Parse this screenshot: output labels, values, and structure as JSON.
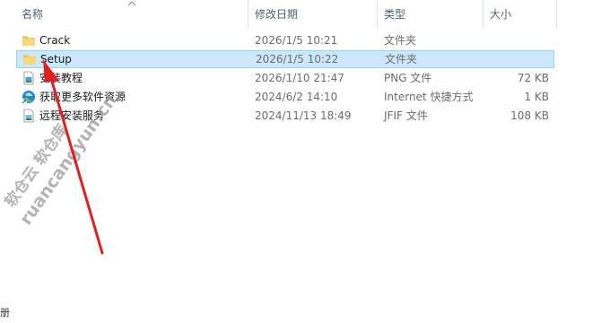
{
  "columns": {
    "name": "名称",
    "modified": "修改日期",
    "type": "类型",
    "size": "大小"
  },
  "files": [
    {
      "icon": "folder-icon",
      "name": "Crack",
      "modified": "2026/1/5 10:21",
      "type": "文件夹",
      "size": "",
      "selected": false
    },
    {
      "icon": "folder-icon",
      "name": "Setup",
      "modified": "2026/1/5 10:22",
      "type": "文件夹",
      "size": "",
      "selected": true
    },
    {
      "icon": "png-file-icon",
      "name": "安装教程",
      "modified": "2026/1/10 21:47",
      "type": "PNG 文件",
      "size": "72 KB",
      "selected": false
    },
    {
      "icon": "edge-shortcut-icon",
      "name": "获取更多软件资源",
      "modified": "2024/6/2 14:10",
      "type": "Internet 快捷方式",
      "size": "1 KB",
      "selected": false
    },
    {
      "icon": "jfif-file-icon",
      "name": "远程安装服务",
      "modified": "2024/11/13 18:49",
      "type": "JFIF 文件",
      "size": "108 KB",
      "selected": false
    }
  ],
  "watermark": {
    "line1": "软仓云 软仓库",
    "line2": "ruancangyun.cn"
  },
  "bottom_glyph": "册",
  "colors": {
    "selection_bg": "#cce8ff",
    "selection_border": "#99d1ff",
    "folder": "#f8d775",
    "arrow": "#e02020",
    "header_text": "#4c607a"
  }
}
